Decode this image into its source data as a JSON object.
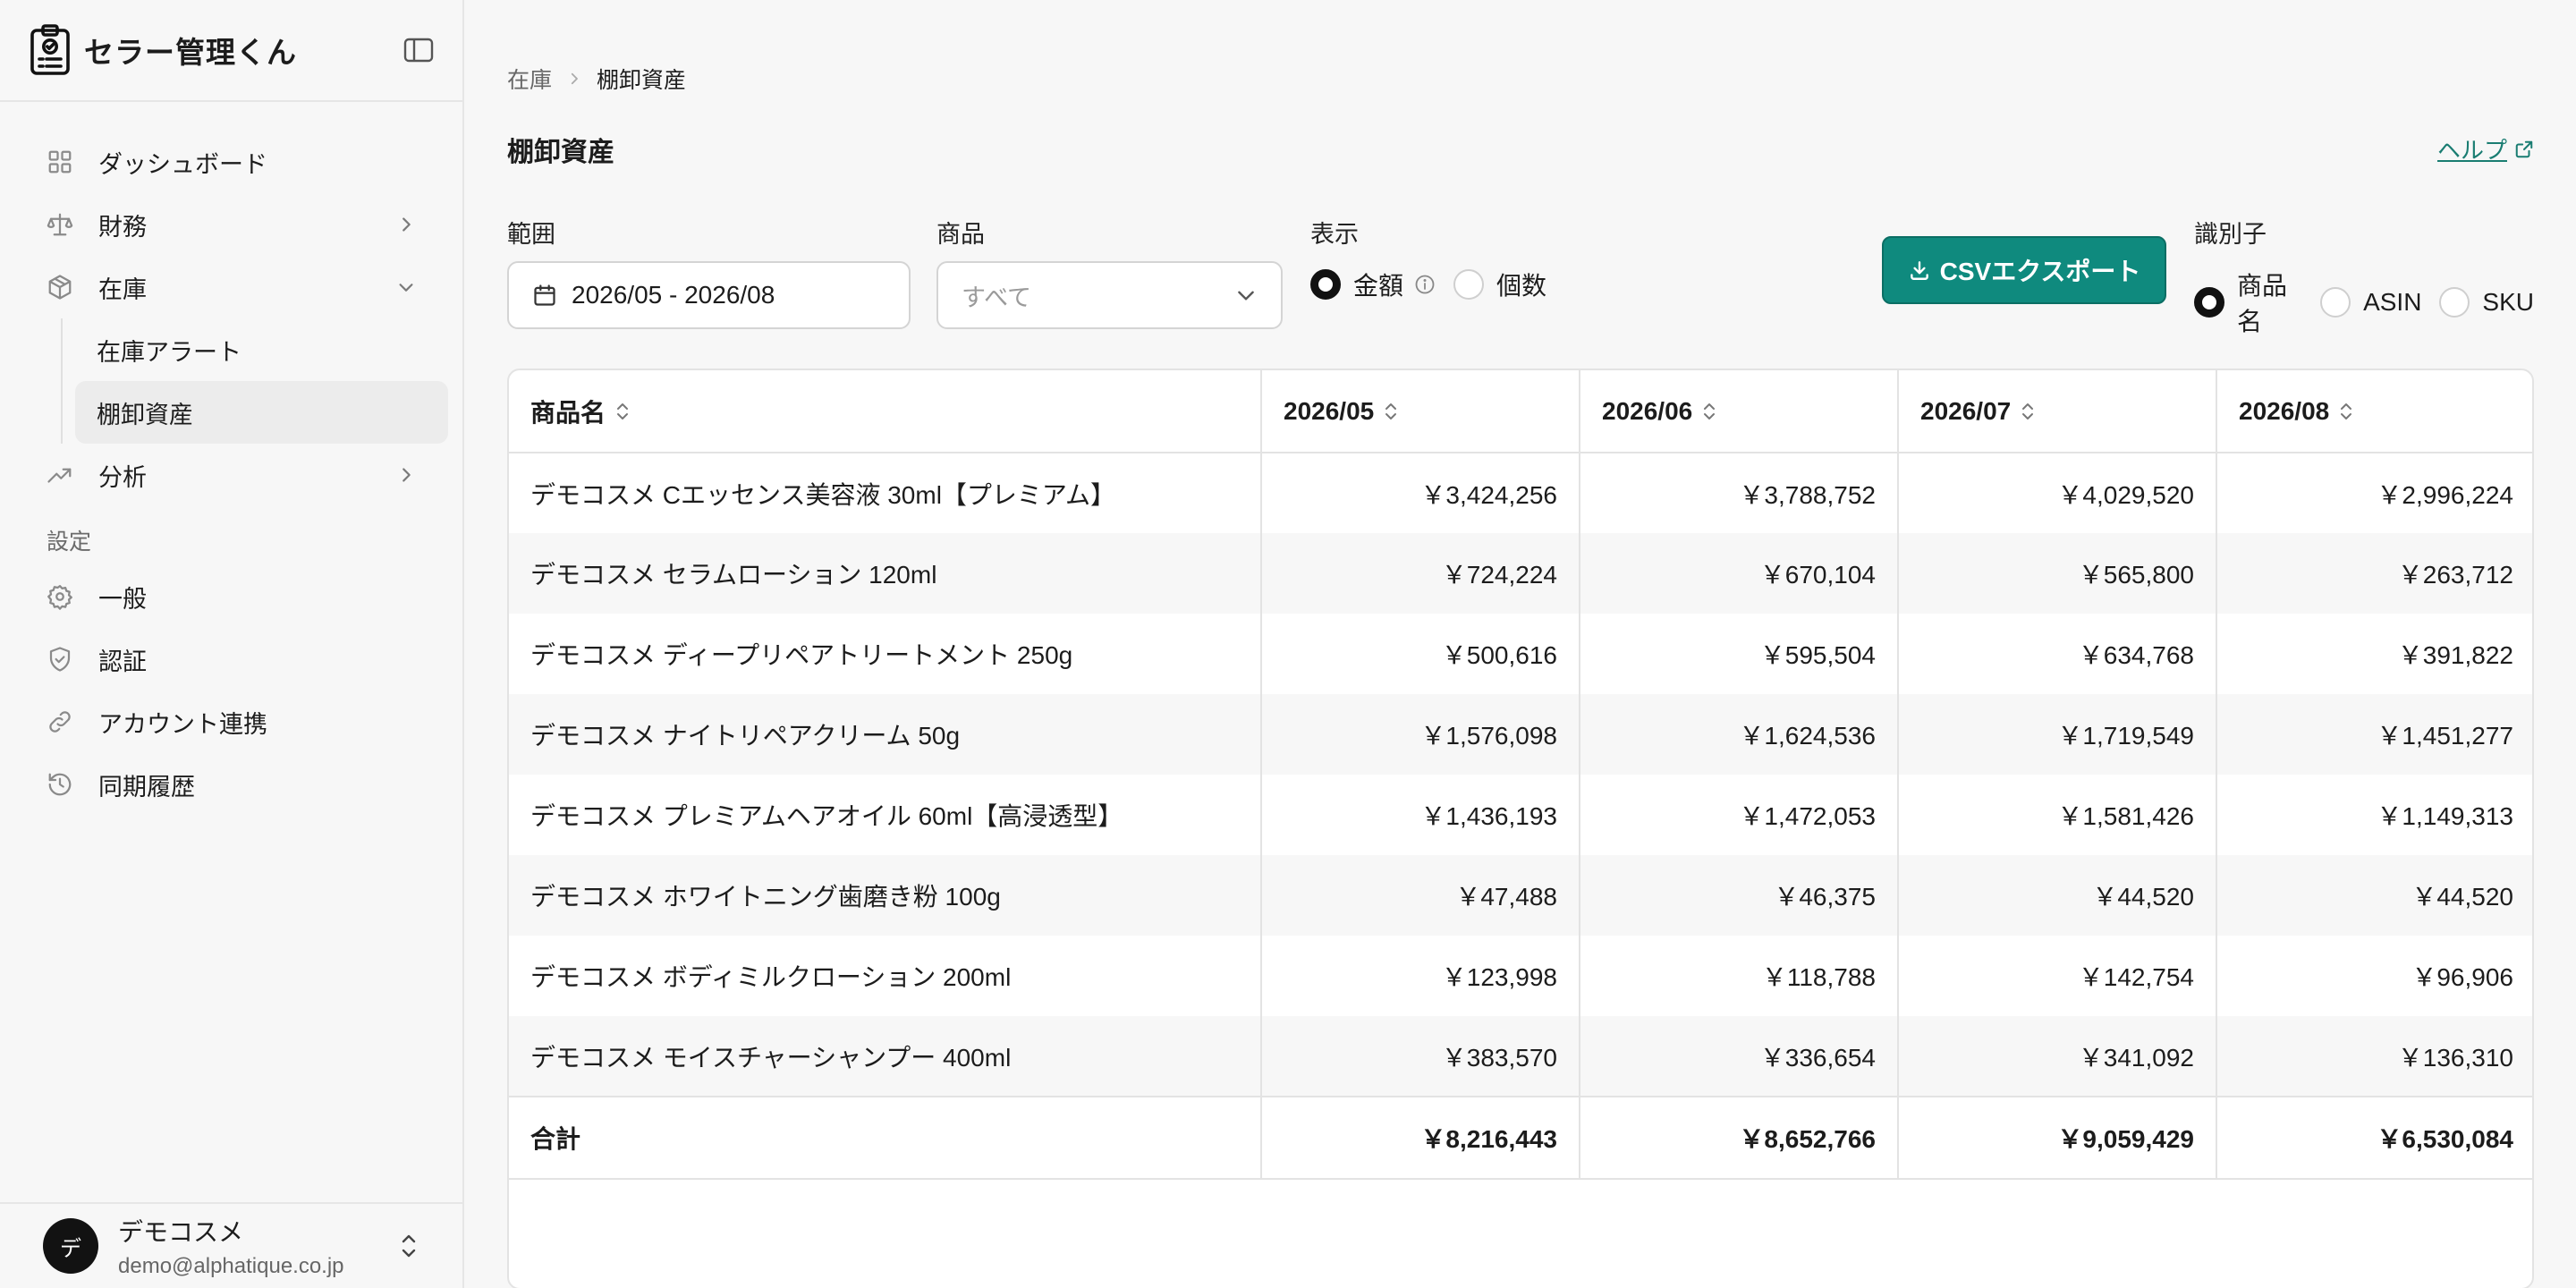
{
  "app": {
    "name": "セラー管理くん"
  },
  "sidebar": {
    "items": [
      {
        "label": "ダッシュボード",
        "icon": "grid-icon"
      },
      {
        "label": "財務",
        "icon": "scale-icon",
        "chevron": "right"
      },
      {
        "label": "在庫",
        "icon": "box-icon",
        "chevron": "down",
        "children": [
          {
            "label": "在庫アラート"
          },
          {
            "label": "棚卸資産",
            "active": true
          }
        ]
      },
      {
        "label": "分析",
        "icon": "trend-icon",
        "chevron": "right"
      }
    ],
    "settings_label": "設定",
    "settings_items": [
      {
        "label": "一般",
        "icon": "gear-icon"
      },
      {
        "label": "認証",
        "icon": "shield-icon"
      },
      {
        "label": "アカウント連携",
        "icon": "link-icon"
      },
      {
        "label": "同期履歴",
        "icon": "history-icon"
      }
    ]
  },
  "user": {
    "avatar": "デ",
    "name": "デモコスメ",
    "email": "demo@alphatique.co.jp"
  },
  "breadcrumb": [
    "在庫",
    "棚卸資産"
  ],
  "page": {
    "title": "棚卸資産",
    "help": "ヘルプ"
  },
  "filters": {
    "range_label": "範囲",
    "range_value": "2026/05 - 2026/08",
    "product_label": "商品",
    "product_placeholder": "すべて",
    "display_label": "表示",
    "display_options": [
      "金額",
      "個数"
    ],
    "display_selected": "金額",
    "csv_button": "CSVエクスポート",
    "identifier_label": "識別子",
    "identifier_options": [
      "商品名",
      "ASIN",
      "SKU"
    ],
    "identifier_selected": "商品名"
  },
  "table": {
    "headers": [
      "商品名",
      "2026/05",
      "2026/06",
      "2026/07",
      "2026/08"
    ],
    "rows": [
      [
        "デモコスメ Cエッセンス美容液 30ml【プレミアム】",
        "￥3,424,256",
        "￥3,788,752",
        "￥4,029,520",
        "￥2,996,224"
      ],
      [
        "デモコスメ セラムローション 120ml",
        "￥724,224",
        "￥670,104",
        "￥565,800",
        "￥263,712"
      ],
      [
        "デモコスメ ディープリペアトリートメント 250g",
        "￥500,616",
        "￥595,504",
        "￥634,768",
        "￥391,822"
      ],
      [
        "デモコスメ ナイトリペアクリーム 50g",
        "￥1,576,098",
        "￥1,624,536",
        "￥1,719,549",
        "￥1,451,277"
      ],
      [
        "デモコスメ プレミアムヘアオイル 60ml【高浸透型】",
        "￥1,436,193",
        "￥1,472,053",
        "￥1,581,426",
        "￥1,149,313"
      ],
      [
        "デモコスメ ホワイトニング歯磨き粉 100g",
        "￥47,488",
        "￥46,375",
        "￥44,520",
        "￥44,520"
      ],
      [
        "デモコスメ ボディミルクローション 200ml",
        "￥123,998",
        "￥118,788",
        "￥142,754",
        "￥96,906"
      ],
      [
        "デモコスメ モイスチャーシャンプー 400ml",
        "￥383,570",
        "￥336,654",
        "￥341,092",
        "￥136,310"
      ]
    ],
    "total": [
      "合計",
      "￥8,216,443",
      "￥8,652,766",
      "￥9,059,429",
      "￥6,530,084"
    ]
  },
  "colors": {
    "accent": "#0f8a7e",
    "link": "#1a7d72"
  }
}
